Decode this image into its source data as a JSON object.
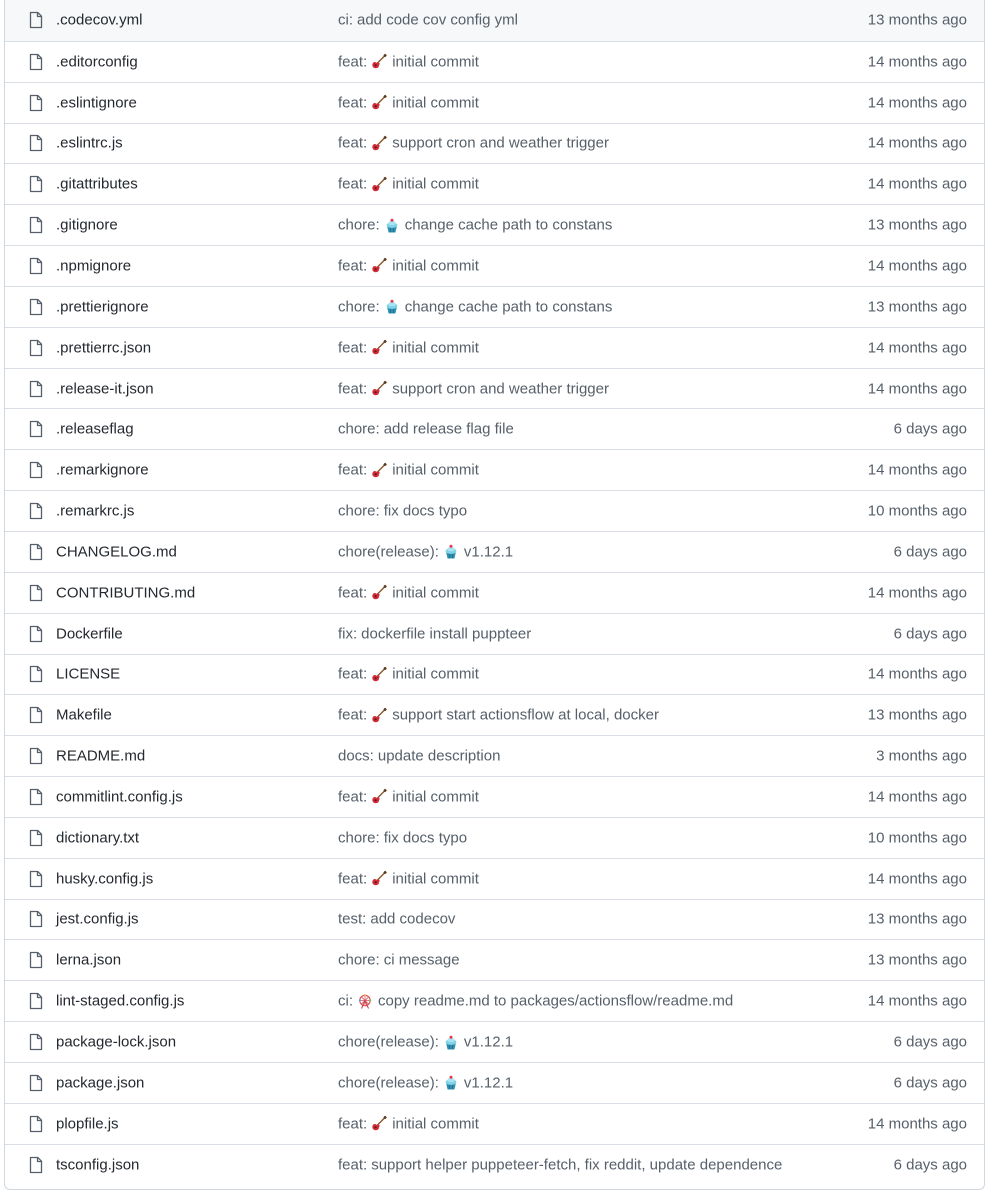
{
  "files": [
    {
      "name": ".codecov.yml",
      "prefix": "ci:",
      "emoji": "",
      "message": "add code cov config yml",
      "date": "13 months ago"
    },
    {
      "name": ".editorconfig",
      "prefix": "feat:",
      "emoji": "guitar-icon",
      "message": "initial commit",
      "date": "14 months ago"
    },
    {
      "name": ".eslintignore",
      "prefix": "feat:",
      "emoji": "guitar-icon",
      "message": "initial commit",
      "date": "14 months ago"
    },
    {
      "name": ".eslintrc.js",
      "prefix": "feat:",
      "emoji": "guitar-icon",
      "message": "support cron and weather trigger",
      "date": "14 months ago"
    },
    {
      "name": ".gitattributes",
      "prefix": "feat:",
      "emoji": "guitar-icon",
      "message": "initial commit",
      "date": "14 months ago"
    },
    {
      "name": ".gitignore",
      "prefix": "chore:",
      "emoji": "cupcake-icon",
      "message": "change cache path to constans",
      "date": "13 months ago"
    },
    {
      "name": ".npmignore",
      "prefix": "feat:",
      "emoji": "guitar-icon",
      "message": "initial commit",
      "date": "14 months ago"
    },
    {
      "name": ".prettierignore",
      "prefix": "chore:",
      "emoji": "cupcake-icon",
      "message": "change cache path to constans",
      "date": "13 months ago"
    },
    {
      "name": ".prettierrc.json",
      "prefix": "feat:",
      "emoji": "guitar-icon",
      "message": "initial commit",
      "date": "14 months ago"
    },
    {
      "name": ".release-it.json",
      "prefix": "feat:",
      "emoji": "guitar-icon",
      "message": "support cron and weather trigger",
      "date": "14 months ago"
    },
    {
      "name": ".releaseflag",
      "prefix": "chore:",
      "emoji": "",
      "message": "add release flag file",
      "date": "6 days ago"
    },
    {
      "name": ".remarkignore",
      "prefix": "feat:",
      "emoji": "guitar-icon",
      "message": "initial commit",
      "date": "14 months ago"
    },
    {
      "name": ".remarkrc.js",
      "prefix": "chore:",
      "emoji": "",
      "message": "fix docs typo",
      "date": "10 months ago"
    },
    {
      "name": "CHANGELOG.md",
      "prefix": "chore(release):",
      "emoji": "cupcake-icon",
      "message": "v1.12.1",
      "date": "6 days ago"
    },
    {
      "name": "CONTRIBUTING.md",
      "prefix": "feat:",
      "emoji": "guitar-icon",
      "message": "initial commit",
      "date": "14 months ago"
    },
    {
      "name": "Dockerfile",
      "prefix": "fix:",
      "emoji": "",
      "message": "dockerfile install puppteer",
      "date": "6 days ago"
    },
    {
      "name": "LICENSE",
      "prefix": "feat:",
      "emoji": "guitar-icon",
      "message": "initial commit",
      "date": "14 months ago"
    },
    {
      "name": "Makefile",
      "prefix": "feat:",
      "emoji": "guitar-icon",
      "message": "support start actionsflow at local, docker",
      "date": "13 months ago"
    },
    {
      "name": "README.md",
      "prefix": "docs:",
      "emoji": "",
      "message": "update description",
      "date": "3 months ago"
    },
    {
      "name": "commitlint.config.js",
      "prefix": "feat:",
      "emoji": "guitar-icon",
      "message": "initial commit",
      "date": "14 months ago"
    },
    {
      "name": "dictionary.txt",
      "prefix": "chore:",
      "emoji": "",
      "message": "fix docs typo",
      "date": "10 months ago"
    },
    {
      "name": "husky.config.js",
      "prefix": "feat:",
      "emoji": "guitar-icon",
      "message": "initial commit",
      "date": "14 months ago"
    },
    {
      "name": "jest.config.js",
      "prefix": "test:",
      "emoji": "",
      "message": "add codecov",
      "date": "13 months ago"
    },
    {
      "name": "lerna.json",
      "prefix": "chore:",
      "emoji": "",
      "message": "ci message",
      "date": "13 months ago"
    },
    {
      "name": "lint-staged.config.js",
      "prefix": "ci:",
      "emoji": "ferris-wheel-icon",
      "message": "copy readme.md to packages/actionsflow/readme.md",
      "date": "14 months ago"
    },
    {
      "name": "package-lock.json",
      "prefix": "chore(release):",
      "emoji": "cupcake-icon",
      "message": "v1.12.1",
      "date": "6 days ago"
    },
    {
      "name": "package.json",
      "prefix": "chore(release):",
      "emoji": "cupcake-icon",
      "message": "v1.12.1",
      "date": "6 days ago"
    },
    {
      "name": "plopfile.js",
      "prefix": "feat:",
      "emoji": "guitar-icon",
      "message": "initial commit",
      "date": "14 months ago"
    },
    {
      "name": "tsconfig.json",
      "prefix": "feat:",
      "emoji": "",
      "message": "support helper puppeteer-fetch, fix reddit, update dependence",
      "date": "6 days ago"
    }
  ],
  "colors": {
    "text": "#24292f",
    "muted": "#57606a",
    "border": "#d0d7de",
    "row_border": "#d8dee4",
    "header_bg": "#f6f8fa",
    "link": "#0969da"
  }
}
